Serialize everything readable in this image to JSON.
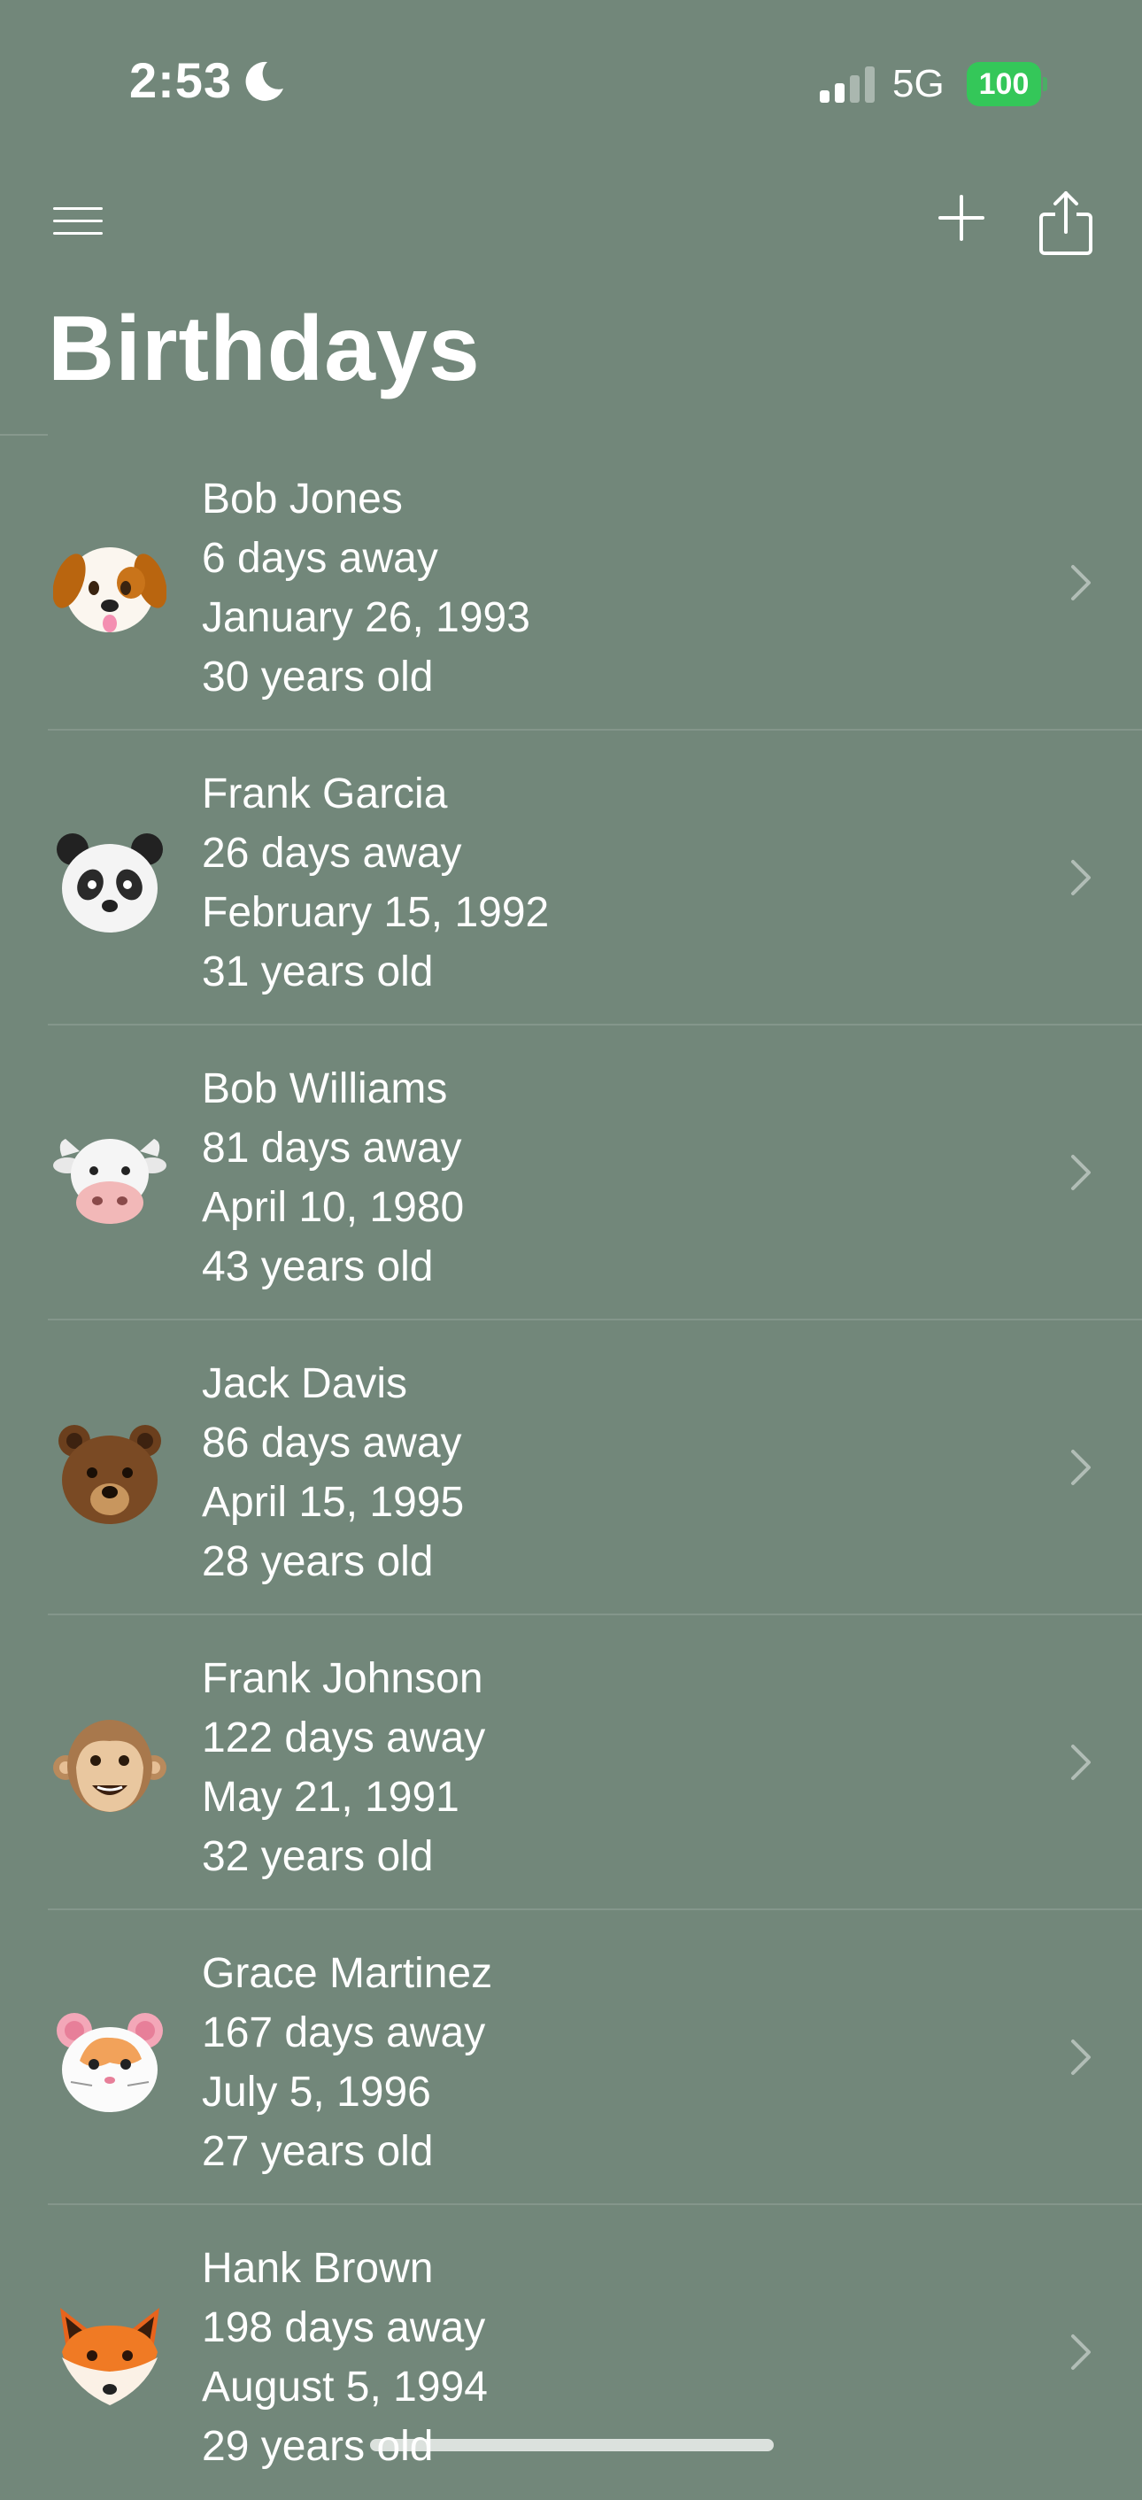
{
  "status_bar": {
    "time": "2:53",
    "network": "5G",
    "battery": "100",
    "battery_color": "#34c759"
  },
  "nav": {
    "menu_icon": "hamburger-menu-icon",
    "add_icon": "plus-icon",
    "share_icon": "share-icon"
  },
  "page": {
    "title": "Birthdays",
    "background": "#72877a"
  },
  "birthdays": [
    {
      "name": "Bob Jones",
      "days_away": "6 days away",
      "date": "January 26, 1993",
      "age": "30 years old",
      "avatar": "dog-face-icon"
    },
    {
      "name": "Frank Garcia",
      "days_away": "26 days away",
      "date": "February 15, 1992",
      "age": "31 years old",
      "avatar": "panda-face-icon"
    },
    {
      "name": "Bob Williams",
      "days_away": "81 days away",
      "date": "April 10, 1980",
      "age": "43 years old",
      "avatar": "cow-face-icon"
    },
    {
      "name": "Jack Davis",
      "days_away": "86 days away",
      "date": "April 15, 1995",
      "age": "28 years old",
      "avatar": "bear-face-icon"
    },
    {
      "name": "Frank Johnson",
      "days_away": "122 days away",
      "date": "May 21, 1991",
      "age": "32 years old",
      "avatar": "monkey-face-icon"
    },
    {
      "name": "Grace Martinez",
      "days_away": "167 days away",
      "date": "July 5, 1996",
      "age": "27 years old",
      "avatar": "hamster-face-icon"
    },
    {
      "name": "Hank Brown",
      "days_away": "198 days away",
      "date": "August 5, 1994",
      "age": "29 years old",
      "avatar": "fox-face-icon"
    }
  ]
}
